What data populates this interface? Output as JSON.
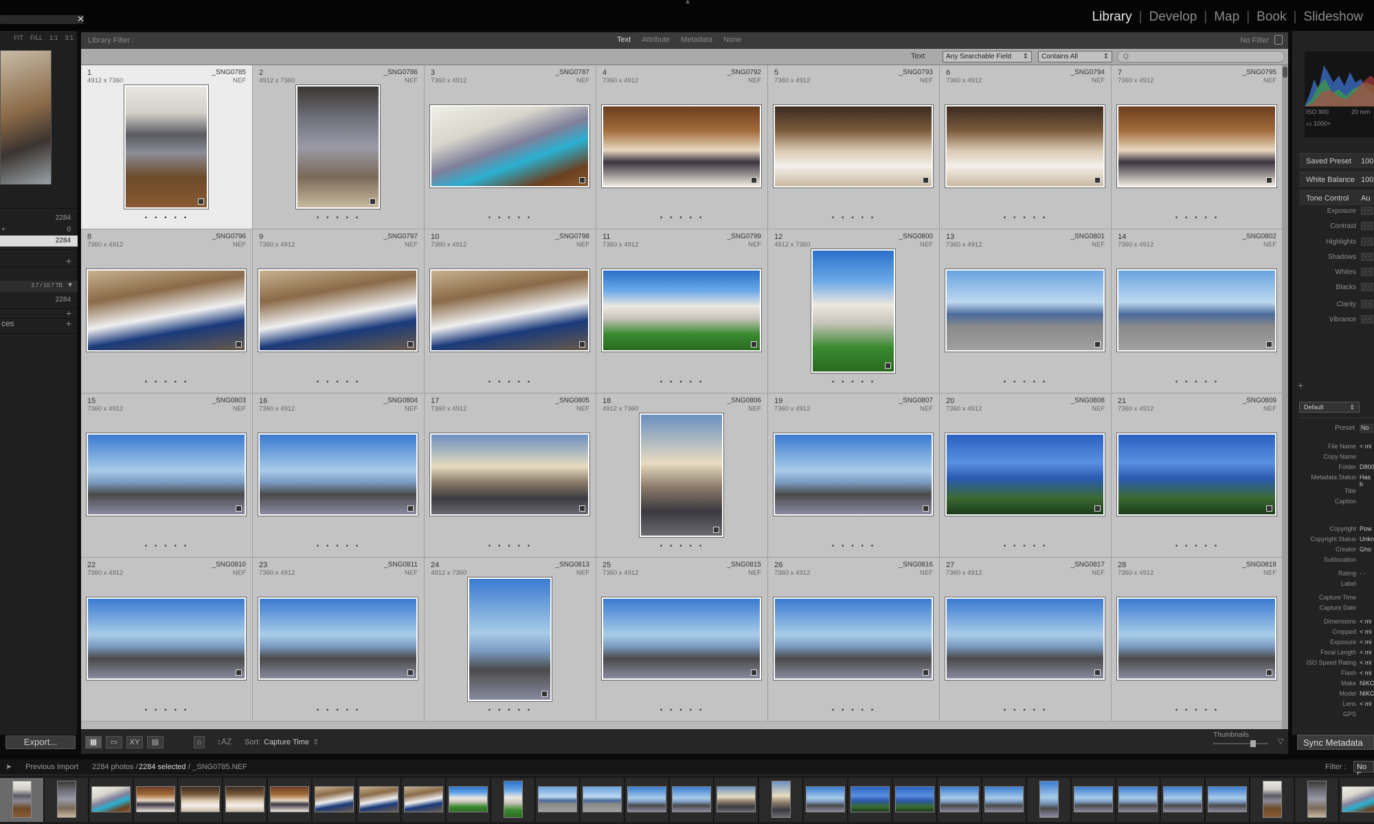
{
  "modules": [
    "Library",
    "Develop",
    "Map",
    "Book",
    "Slideshow"
  ],
  "active_module": "Library",
  "navigator": {
    "options": [
      "FIT",
      "FILL",
      "1:1",
      "3:1"
    ]
  },
  "catalog": {
    "all_photos_count": "2284",
    "quick_collection_count": "0",
    "previous_import_count": "2284"
  },
  "folders": {
    "volume": "3.7 / 10.7 TB",
    "count": "2284"
  },
  "publish_services_label": "ces",
  "filter_bar": {
    "title": "Library Filter :",
    "tabs": [
      "Text",
      "Attribute",
      "Metadata",
      "None"
    ],
    "active_tab": "Text",
    "no_filter": "No Filter"
  },
  "text_filter": {
    "label": "Text",
    "field": "Any Searchable Field",
    "rule": "Contains All",
    "search_placeholder": "Q"
  },
  "cells": [
    {
      "idx": "1",
      "name": "_SNG0785",
      "dim": "4912 x 7360",
      "ext": "NEF",
      "orient": "port",
      "palette": "suitcase"
    },
    {
      "idx": "2",
      "name": "_SNG0786",
      "dim": "4912 x 7360",
      "ext": "NEF",
      "orient": "port",
      "palette": "suitcase2"
    },
    {
      "idx": "3",
      "name": "_SNG0787",
      "dim": "7360 x 4912",
      "ext": "NEF",
      "orient": "land",
      "palette": "bag"
    },
    {
      "idx": "4",
      "name": "_SNG0792",
      "dim": "7360 x 4912",
      "ext": "NEF",
      "orient": "land",
      "palette": "lobby"
    },
    {
      "idx": "5",
      "name": "_SNG0793",
      "dim": "7360 x 4912",
      "ext": "NEF",
      "orient": "land",
      "palette": "lobby2"
    },
    {
      "idx": "6",
      "name": "_SNG0794",
      "dim": "7360 x 4912",
      "ext": "NEF",
      "orient": "land",
      "palette": "lobby2"
    },
    {
      "idx": "7",
      "name": "_SNG0795",
      "dim": "7360 x 4912",
      "ext": "NEF",
      "orient": "land",
      "palette": "lobby"
    },
    {
      "idx": "8",
      "name": "_SNG0796",
      "dim": "7360 x 4912",
      "ext": "NEF",
      "orient": "land",
      "palette": "room"
    },
    {
      "idx": "9",
      "name": "_SNG0797",
      "dim": "7360 x 4912",
      "ext": "NEF",
      "orient": "land",
      "palette": "room"
    },
    {
      "idx": "10",
      "name": "_SNG0798",
      "dim": "7360 x 4912",
      "ext": "NEF",
      "orient": "land",
      "palette": "room"
    },
    {
      "idx": "11",
      "name": "_SNG0799",
      "dim": "7360 x 4912",
      "ext": "NEF",
      "orient": "land",
      "palette": "hotel"
    },
    {
      "idx": "12",
      "name": "_SNG0800",
      "dim": "4912 x 7360",
      "ext": "NEF",
      "orient": "port",
      "palette": "hotel"
    },
    {
      "idx": "13",
      "name": "_SNG0801",
      "dim": "7360 x 4912",
      "ext": "NEF",
      "orient": "land",
      "palette": "beach"
    },
    {
      "idx": "14",
      "name": "_SNG0802",
      "dim": "7360 x 4912",
      "ext": "NEF",
      "orient": "land",
      "palette": "beach"
    },
    {
      "idx": "15",
      "name": "_SNG0803",
      "dim": "7360 x 4912",
      "ext": "NEF",
      "orient": "land",
      "palette": "sea"
    },
    {
      "idx": "16",
      "name": "_SNG0804",
      "dim": "7360 x 4912",
      "ext": "NEF",
      "orient": "land",
      "palette": "sea"
    },
    {
      "idx": "17",
      "name": "_SNG0805",
      "dim": "7360 x 4912",
      "ext": "NEF",
      "orient": "land",
      "palette": "promenade"
    },
    {
      "idx": "18",
      "name": "_SNG0806",
      "dim": "4912 x 7360",
      "ext": "NEF",
      "orient": "port",
      "palette": "promenade"
    },
    {
      "idx": "19",
      "name": "_SNG0807",
      "dim": "7360 x 4912",
      "ext": "NEF",
      "orient": "land",
      "palette": "sea"
    },
    {
      "idx": "20",
      "name": "_SNG0808",
      "dim": "7360 x 4912",
      "ext": "NEF",
      "orient": "land",
      "palette": "sculpture"
    },
    {
      "idx": "21",
      "name": "_SNG0809",
      "dim": "7360 x 4912",
      "ext": "NEF",
      "orient": "land",
      "palette": "sculpture"
    },
    {
      "idx": "22",
      "name": "_SNG0810",
      "dim": "7360 x 4912",
      "ext": "NEF",
      "orient": "land",
      "palette": "sea"
    },
    {
      "idx": "23",
      "name": "_SNG0811",
      "dim": "7360 x 4912",
      "ext": "NEF",
      "orient": "land",
      "palette": "sea"
    },
    {
      "idx": "24",
      "name": "_SNG0813",
      "dim": "4912 x 7360",
      "ext": "NEF",
      "orient": "port",
      "palette": "sea"
    },
    {
      "idx": "25",
      "name": "_SNG0815",
      "dim": "7360 x 4912",
      "ext": "NEF",
      "orient": "land",
      "palette": "sea"
    },
    {
      "idx": "26",
      "name": "_SNG0816",
      "dim": "7360 x 4912",
      "ext": "NEF",
      "orient": "land",
      "palette": "sea"
    },
    {
      "idx": "27",
      "name": "_SNG0817",
      "dim": "7360 x 4912",
      "ext": "NEF",
      "orient": "land",
      "palette": "sea"
    },
    {
      "idx": "28",
      "name": "_SNG0818",
      "dim": "7360 x 4912",
      "ext": "NEF",
      "orient": "land",
      "palette": "sea"
    }
  ],
  "toolbar": {
    "sort_label": "Sort:",
    "sort_value": "Capture Time",
    "thumbnails_label": "Thumbnails",
    "thumbnail_size": 0.72
  },
  "export_label": "Export...",
  "sync_label": "Sync Metadata",
  "filmstrip_header": {
    "source": "Previous Import",
    "count": "2284 photos /",
    "selected": "2284 selected",
    "file": "/ _SNG0785.NEF",
    "filter_label": "Filter :",
    "filter_value": "No F"
  },
  "right_panel": {
    "iso": "ISO 900",
    "focal": "20 mm",
    "preview_label": "1000+",
    "saved_preset": "Saved Preset",
    "saved_preset_val": "100",
    "white_balance": "White Balance",
    "white_balance_val": "100",
    "tone_control": "Tone Control",
    "tone_control_val": "Au",
    "tone_items": [
      "Exposure",
      "Contrast",
      "Highlights",
      "Shadows",
      "Whites",
      "Blacks",
      "Clarity",
      "Vibrance"
    ],
    "metadata_preset_label": "Default",
    "preset_label": "Preset",
    "preset_val": "No",
    "meta_rows": [
      {
        "label": "File Name",
        "val": "< mi"
      },
      {
        "label": "Copy Name",
        "val": ""
      },
      {
        "label": "Folder",
        "val": "D800"
      },
      {
        "label": "Metadata Status",
        "val": "Has b"
      },
      {
        "label": "Title",
        "val": ""
      },
      {
        "label": "Caption",
        "val": ""
      },
      {
        "label": "Copyright",
        "val": "Pow"
      },
      {
        "label": "Copyright Status",
        "val": "Unkn"
      },
      {
        "label": "Creator",
        "val": "Gho"
      },
      {
        "label": "Sublocation",
        "val": ""
      },
      {
        "label": "Rating",
        "val": "·  ·"
      },
      {
        "label": "Label",
        "val": ""
      },
      {
        "label": "Capture Time",
        "val": ""
      },
      {
        "label": "Capture Date",
        "val": ""
      },
      {
        "label": "Dimensions",
        "val": "< mi"
      },
      {
        "label": "Cropped",
        "val": "< mi"
      },
      {
        "label": "Exposure",
        "val": "< mi"
      },
      {
        "label": "Focal Length",
        "val": "< mi"
      },
      {
        "label": "ISO Speed Rating",
        "val": "< mi"
      },
      {
        "label": "Flash",
        "val": "< mi"
      },
      {
        "label": "Make",
        "val": "NIKC"
      },
      {
        "label": "Model",
        "val": "NIKC"
      },
      {
        "label": "Lens",
        "val": "< mi"
      },
      {
        "label": "GPS",
        "val": ""
      }
    ]
  },
  "palettes": {
    "suitcase": "linear-gradient(180deg,#eae6e0 0%,#d2cfc8 22%,#5a5a62 40%,#8c8c96 55%,#6b4a2a 75%,#8a5a32 100%)",
    "suitcase2": "linear-gradient(180deg,#3a3530 0%,#6d6e78 25%,#9a9aa6 50%,#7a6a58 75%,#c8b9a0 100%)",
    "bag": "linear-gradient(160deg,#efefe8 0%,#d8d6cc 30%,#7f7f9a 50%,#2bb0d0 65%,#6a4020 85%,#8a5a30 100%)",
    "lobby": "linear-gradient(180deg,#6b3e20 0%,#a26a3a 30%,#e8d8c0 55%,#3a3440 70%,#f0e8e0 100%)",
    "lobby2": "linear-gradient(180deg,#3a2a20 0%,#7a5a3a 30%,#d8c8b0 55%,#f4f0ea 75%,#c8b8a0 100%)",
    "room": "linear-gradient(170deg,#c8b290 0%,#8a6a48 30%,#f0f0f0 55%,#1a3a7a 72%,#6a5a4a 100%)",
    "hotel": "linear-gradient(180deg,#2a70c8 0%,#6aa8e8 25%,#ece8e0 45%,#c8c4bc 60%,#3a8a30 80%,#2a6a20 100%)",
    "beach": "linear-gradient(180deg,#6aa4e0 0%,#bcd8f0 40%,#4a6a9a 55%,#8a8a8a 70%,#a0a0a0 100%)",
    "sea": "linear-gradient(180deg,#3a7ad0 0%,#a8cce8 45%,#7a9ac0 60%,#4a4a4a 75%,#8a8aa0 100%)",
    "promenade": "linear-gradient(180deg,#6a90c0 0%,#e8dcc0 40%,#8a7a6a 60%,#3a3a40 80%,#6a6a70 100%)",
    "sculpture": "linear-gradient(180deg,#2a60c0 0%,#5a90e0 35%,#2a5ab0 55%,#3a6a30 80%,#1a3a1a 100%)"
  }
}
